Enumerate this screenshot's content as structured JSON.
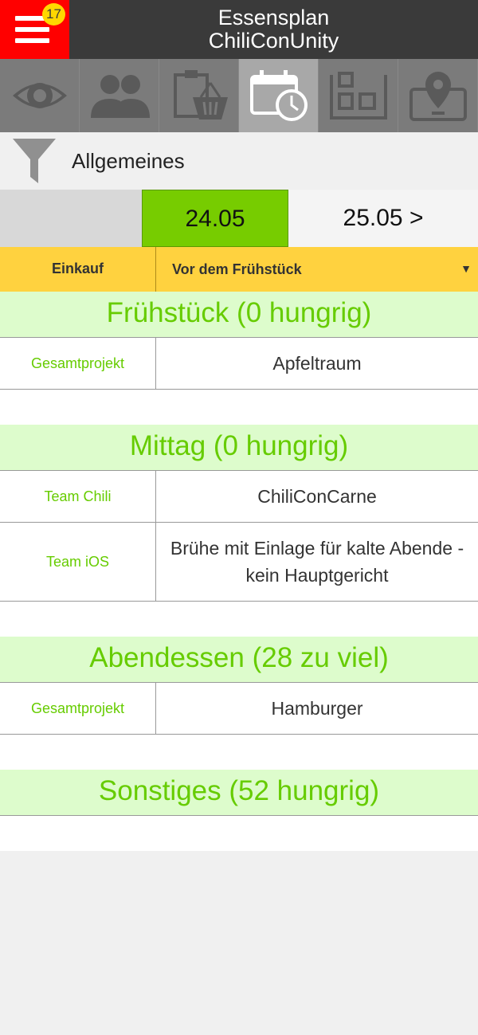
{
  "header": {
    "title_line1": "Essensplan",
    "title_line2": "ChiliConUnity",
    "badge_count": "17",
    "menu_color": "#ff0000"
  },
  "tabs": [
    {
      "icon": "eye-icon",
      "active": false
    },
    {
      "icon": "people-icon",
      "active": false
    },
    {
      "icon": "shopping-basket-icon",
      "active": false
    },
    {
      "icon": "calendar-clock-icon",
      "active": true
    },
    {
      "icon": "layout-grid-icon",
      "active": false
    },
    {
      "icon": "map-pin-icon",
      "active": false
    }
  ],
  "filter": {
    "icon": "funnel-icon",
    "label": "Allgemeines"
  },
  "dates": {
    "current": "24.05",
    "next": "25.05 >",
    "current_color": "#77cc00"
  },
  "selector": {
    "label": "Einkauf",
    "value": "Vor dem Frühstück",
    "arrow": "▼"
  },
  "sections": [
    {
      "title": "Frühstück (0 hungrig)",
      "rows": [
        {
          "team": "Gesamtprojekt",
          "dish": "Apfeltraum"
        }
      ]
    },
    {
      "title": "Mittag (0 hungrig)",
      "rows": [
        {
          "team": "Team Chili",
          "dish": "ChiliConCarne"
        },
        {
          "team": "Team iOS",
          "dish": "Brühe mit Einlage für kalte Abende - kein Hauptgericht"
        }
      ]
    },
    {
      "title": "Abendessen (28 zu viel)",
      "rows": [
        {
          "team": "Gesamtprojekt",
          "dish": "Hamburger"
        }
      ]
    },
    {
      "title": "Sonstiges (52 hungrig)",
      "rows": []
    }
  ],
  "colors": {
    "accent_green": "#66cc00",
    "section_bg": "#ddfccc",
    "selector_bg": "#ffd23f"
  }
}
